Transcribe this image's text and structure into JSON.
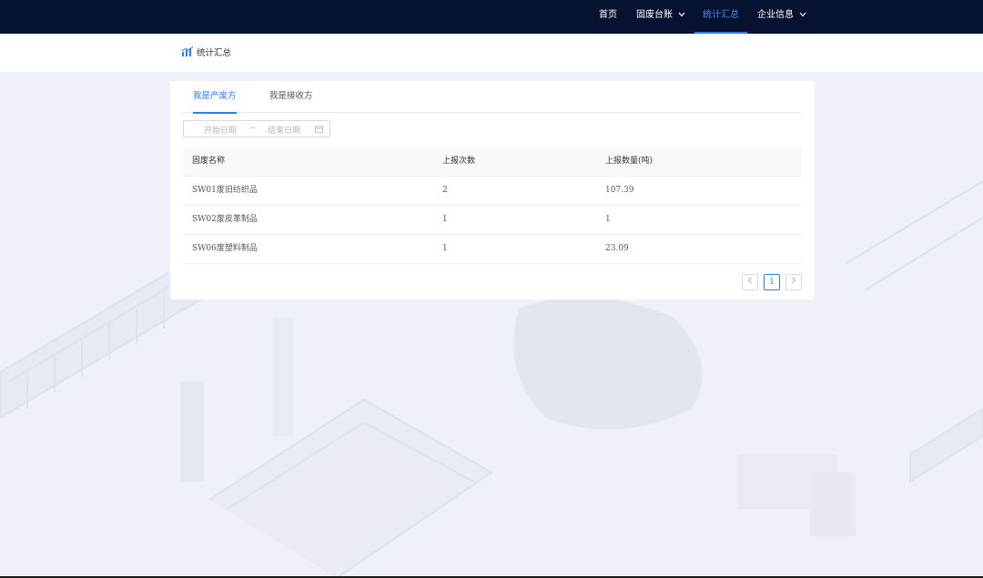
{
  "topnav": {
    "items": [
      {
        "label": "首页",
        "has_dropdown": false,
        "active": false
      },
      {
        "label": "固废台账",
        "has_dropdown": true,
        "active": false
      },
      {
        "label": "统计汇总",
        "has_dropdown": false,
        "active": true
      },
      {
        "label": "企业信息",
        "has_dropdown": true,
        "active": false
      }
    ],
    "dropdown_icon": "chevron-down-icon"
  },
  "subheader": {
    "icon": "bar-chart-icon",
    "title": "统计汇总"
  },
  "tabs": [
    {
      "label": "我是产废方",
      "active": true
    },
    {
      "label": "我是接收方",
      "active": false
    }
  ],
  "date_range": {
    "start_placeholder": "开始日期",
    "separator": "~",
    "end_placeholder": "结束日期",
    "icon": "calendar-icon"
  },
  "table": {
    "columns": [
      "固废名称",
      "上报次数",
      "上报数量(吨)"
    ],
    "rows": [
      [
        "SW01废旧纺织品",
        "2",
        "107.39"
      ],
      [
        "SW02废皮革制品",
        "1",
        "1"
      ],
      [
        "SW06废塑料制品",
        "1",
        "23.09"
      ]
    ]
  },
  "pagination": {
    "current_page": "1",
    "prev_icon": "chevron-left-icon",
    "next_icon": "chevron-right-icon"
  },
  "colors": {
    "topbar": "#051330",
    "accent": "#2f7bf0",
    "page_bg": "#eef1f8"
  }
}
